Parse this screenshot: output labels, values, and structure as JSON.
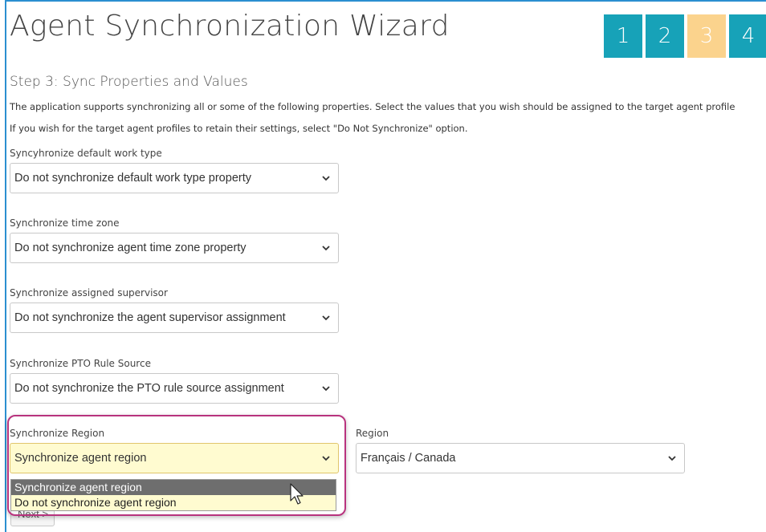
{
  "header": {
    "title": "Agent Synchronization Wizard",
    "steps": [
      "1",
      "2",
      "3",
      "4"
    ],
    "current_step": 3
  },
  "step": {
    "heading": "Step 3: Sync Properties and Values",
    "desc_1": "The application supports synchronizing all or some of the following properties. Select the values that you wish should be assigned to the target agent profile",
    "desc_2": "If you wish for the target agent profiles to retain their settings, select \"Do Not Synchronize\" option."
  },
  "fields": {
    "work_type": {
      "label": "Syncyhronize default work type",
      "value": "Do not synchronize default work type property"
    },
    "time_zone": {
      "label": "Synchronize time zone",
      "value": "Do not synchronize agent time zone property"
    },
    "supervisor": {
      "label": "Synchronize assigned supervisor",
      "value": "Do not synchronize the agent supervisor assignment"
    },
    "pto": {
      "label": "Synchronize PTO Rule Source",
      "value": "Do not synchronize the PTO rule source assignment"
    },
    "region_sync": {
      "label": "Synchronize Region",
      "value": "Synchronize agent region",
      "options": [
        "Synchronize agent region",
        "Do not synchronize agent region"
      ]
    },
    "region": {
      "label": "Region",
      "value": "Français / Canada"
    }
  },
  "buttons": {
    "next_label": "Next >"
  },
  "colors": {
    "step_accent": "#17a2b8",
    "step_current": "#fbd38d",
    "highlight_border": "#b8337e"
  },
  "icons": {
    "select_arrow": "chevron-down-icon",
    "cursor": "mouse-pointer-icon"
  }
}
